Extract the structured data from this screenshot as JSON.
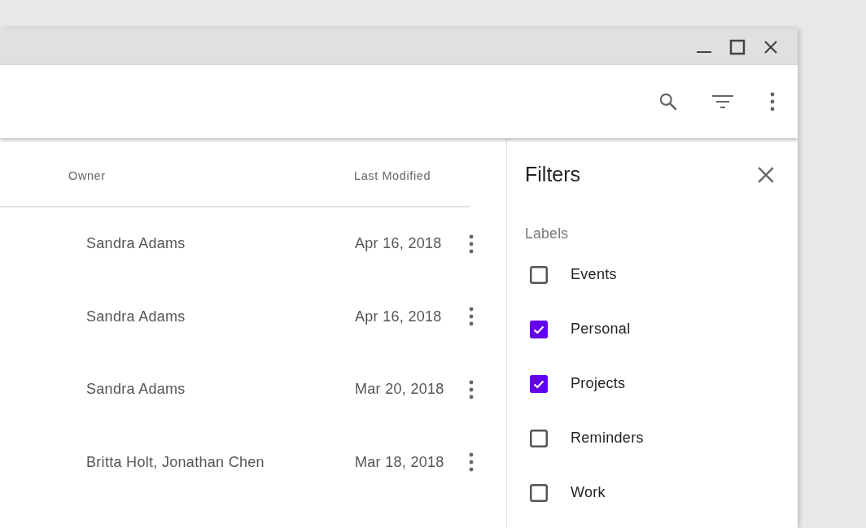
{
  "table": {
    "columns": [
      "Owner",
      "Last Modified"
    ],
    "rows": [
      {
        "owner": "Sandra Adams",
        "last_modified": "Apr 16, 2018"
      },
      {
        "owner": "Sandra Adams",
        "last_modified": "Apr 16, 2018"
      },
      {
        "owner": "Sandra Adams",
        "last_modified": "Mar 20, 2018"
      },
      {
        "owner": "Britta Holt, Jonathan Chen",
        "last_modified": "Mar 18, 2018"
      }
    ]
  },
  "filters": {
    "title": "Filters",
    "section": "Labels",
    "labels": [
      {
        "label": "Events",
        "checked": false
      },
      {
        "label": "Personal",
        "checked": true
      },
      {
        "label": "Projects",
        "checked": true
      },
      {
        "label": "Reminders",
        "checked": false
      },
      {
        "label": "Work",
        "checked": false
      }
    ]
  }
}
